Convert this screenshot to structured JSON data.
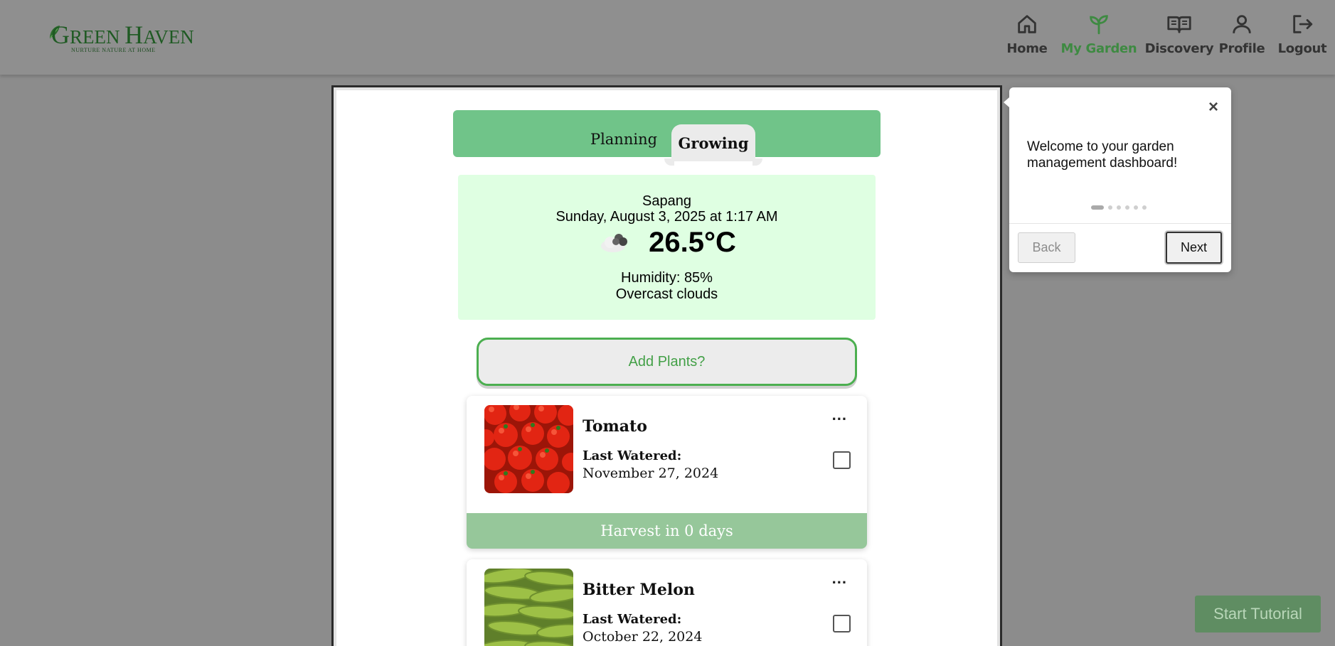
{
  "brand": {
    "name": "GreenHaven",
    "name_part1": "G",
    "name_part2": "REEN ",
    "name_part3": "H",
    "name_part4": "AVEN",
    "tagline": "NURTURE NATURE AT HOME",
    "color": "#1f5a23"
  },
  "nav": {
    "items": [
      {
        "label": "Home",
        "icon": "home-icon"
      },
      {
        "label": "My Garden",
        "icon": "sprout-icon",
        "active": true
      },
      {
        "label": "Discovery",
        "icon": "book-icon"
      },
      {
        "label": "Profile",
        "icon": "user-icon"
      },
      {
        "label": "Logout",
        "icon": "logout-icon"
      }
    ],
    "active_color": "#3e8a42"
  },
  "tabs": {
    "planning": "Planning",
    "growing": "Growing",
    "active": "Growing",
    "bar_color": "#70c489"
  },
  "weather": {
    "city": "Sapang",
    "datetime": "Sunday, August 3, 2025 at 1:17 AM",
    "icon": "cloud-icon",
    "temperature": "26.5°C",
    "humidity": "Humidity: 85%",
    "description": "Overcast clouds",
    "bg_color": "#dfffe2"
  },
  "add_plants": {
    "label": "Add Plants?"
  },
  "plants": [
    {
      "name": "Tomato",
      "last_watered_label": "Last Watered:",
      "last_watered_date": "November 27, 2024",
      "menu": "...",
      "harvest": "Harvest in 0 days",
      "checked": false
    },
    {
      "name": "Bitter Melon",
      "last_watered_label": "Last Watered:",
      "last_watered_date": "October 22, 2024",
      "menu": "...",
      "checked": false
    }
  ],
  "tutorial": {
    "close": "×",
    "message": "Welcome to your garden management dashboard!",
    "steps_total": 6,
    "current_step": 1,
    "back_label": "Back",
    "next_label": "Next",
    "start_label": "Start Tutorial"
  }
}
